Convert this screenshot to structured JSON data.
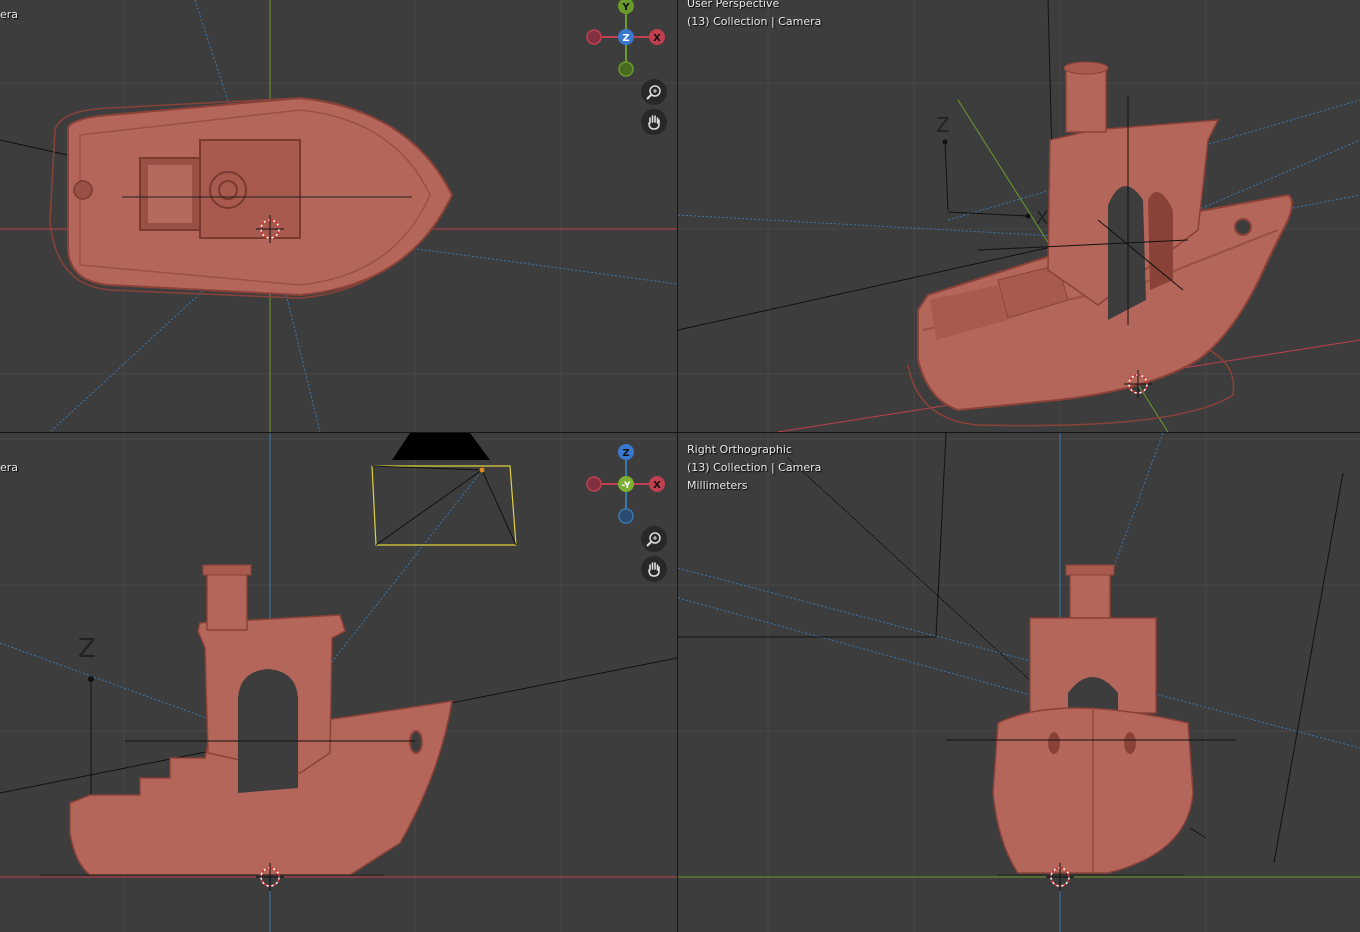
{
  "viewports": {
    "top": {
      "line1": "era"
    },
    "perspective": {
      "line1": "User Perspective",
      "line2": "(13) Collection | Camera"
    },
    "front": {
      "line1": "era"
    },
    "right": {
      "line1": "Right Orthographic",
      "line2": "(13) Collection | Camera",
      "line3": "Millimeters"
    }
  },
  "gizmo_top": {
    "top": "Y",
    "center": "Z",
    "right": "X"
  },
  "gizmo_front": {
    "top": "Z",
    "center": "-Y",
    "right": "X"
  },
  "axis_labels": {
    "z": "Z",
    "x": "X"
  },
  "icons": {
    "zoom": "zoom-magnifier-icon",
    "pan": "pan-hand-icon",
    "cursor": "3d-cursor-icon"
  },
  "colors": {
    "background": "#3d3d3d",
    "grid": "#474747",
    "x_axis": "#c0404f",
    "y_axis": "#6a9a2a",
    "z_axis": "#3a78b0",
    "model": "#b5665a",
    "model_shadow": "#8a4238",
    "selection": "#e0d040"
  }
}
